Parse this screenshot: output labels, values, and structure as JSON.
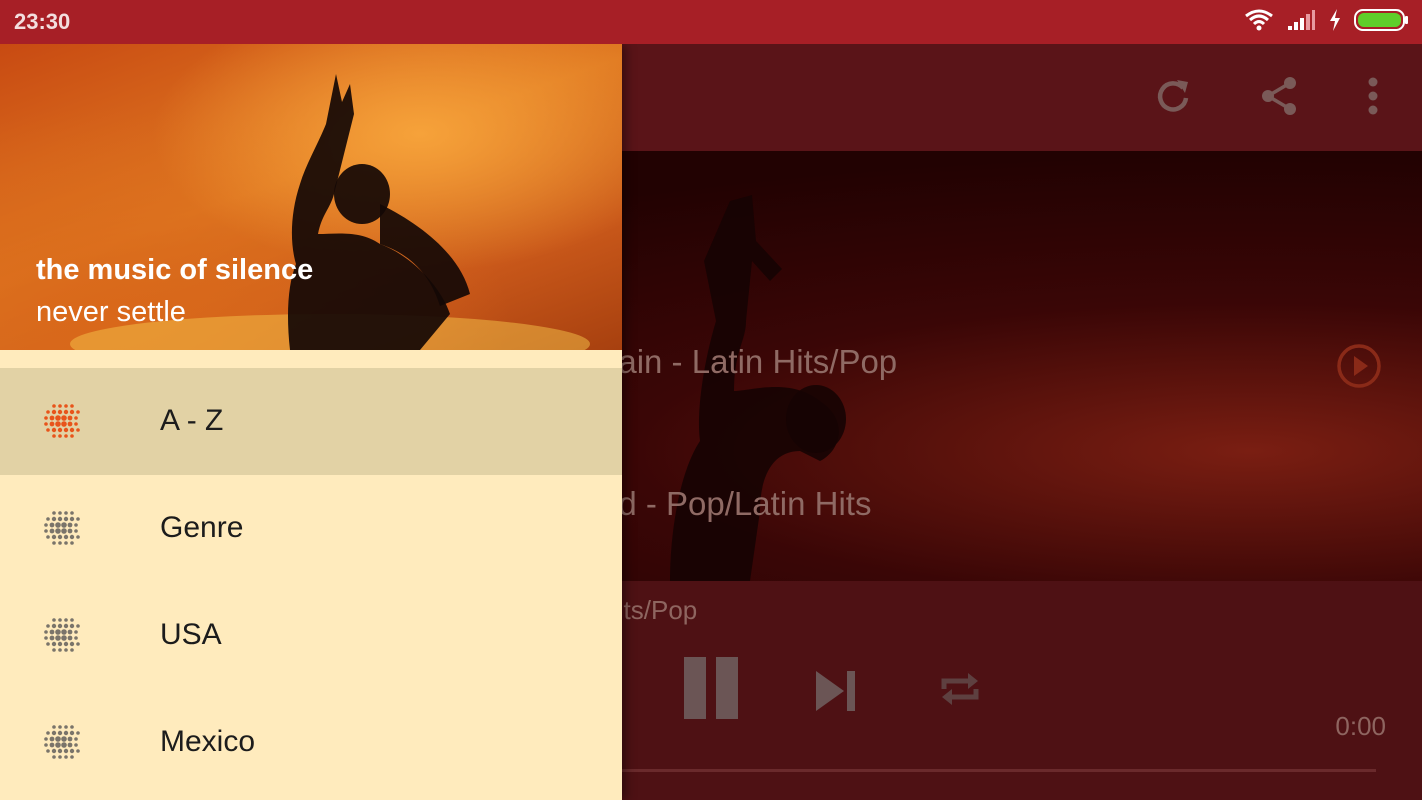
{
  "status": {
    "time": "23:30",
    "icons": [
      "wifi-icon",
      "signal-icon",
      "charging-icon",
      "battery-icon"
    ]
  },
  "toolbar": {
    "icons": [
      "refresh-icon",
      "share-icon",
      "more-vert-icon"
    ]
  },
  "content": {
    "rows": [
      {
        "text": "pain - Latin Hits/Pop"
      },
      {
        "text": "nd - Pop/Latin Hits"
      }
    ]
  },
  "player": {
    "now_playing": "lits/Pop",
    "time": "0:00",
    "controls": [
      "pause-icon",
      "skip-next-icon",
      "repeat-icon"
    ]
  },
  "drawer": {
    "header": {
      "title": "the music of silence",
      "subtitle": "never settle"
    },
    "menu": [
      {
        "label": "A - Z",
        "selected": true
      },
      {
        "label": "Genre",
        "selected": false
      },
      {
        "label": "USA",
        "selected": false
      },
      {
        "label": "Mexico",
        "selected": false
      }
    ]
  },
  "colors": {
    "status_bar": "#a71f26",
    "drawer_bg": "#ffebbd",
    "selected_item": "#e2d2a5",
    "accent": "#e8541a"
  }
}
